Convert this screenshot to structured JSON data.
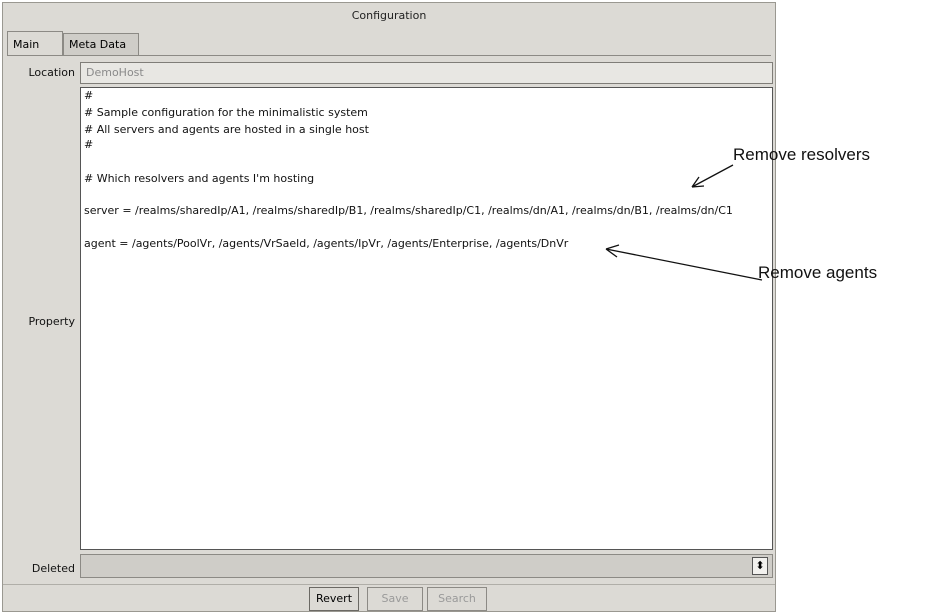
{
  "window": {
    "title": "Configuration"
  },
  "tabs": [
    {
      "label": "Main",
      "active": true
    },
    {
      "label": "Meta Data",
      "active": false
    }
  ],
  "fields": {
    "location_label": "Location",
    "location_value": "DemoHost",
    "property_label": "Property",
    "property_lines": [
      "#",
      "# Sample configuration for the minimalistic system",
      "# All servers and agents are hosted in a single host",
      "#",
      "",
      "# Which resolvers and agents I'm hosting",
      "",
      "server = /realms/sharedIp/A1, /realms/sharedIp/B1, /realms/sharedIp/C1, /realms/dn/A1, /realms/dn/B1, /realms/dn/C1",
      "",
      "agent = /agents/PoolVr, /agents/VrSaeld, /agents/IpVr, /agents/Enterprise, /agents/DnVr"
    ],
    "deleted_label": "Deleted",
    "deleted_value": ""
  },
  "buttons": {
    "revert": "Revert",
    "save": "Save",
    "search": "Search"
  },
  "annotations": {
    "resolvers": "Remove resolvers",
    "agents": "Remove agents"
  },
  "icons": {
    "spinner": "up-down-spinner-icon"
  },
  "colors": {
    "window_bg": "#dcdad5",
    "text_area_bg": "#ffffff",
    "disabled_text": "#9a9a9a"
  }
}
